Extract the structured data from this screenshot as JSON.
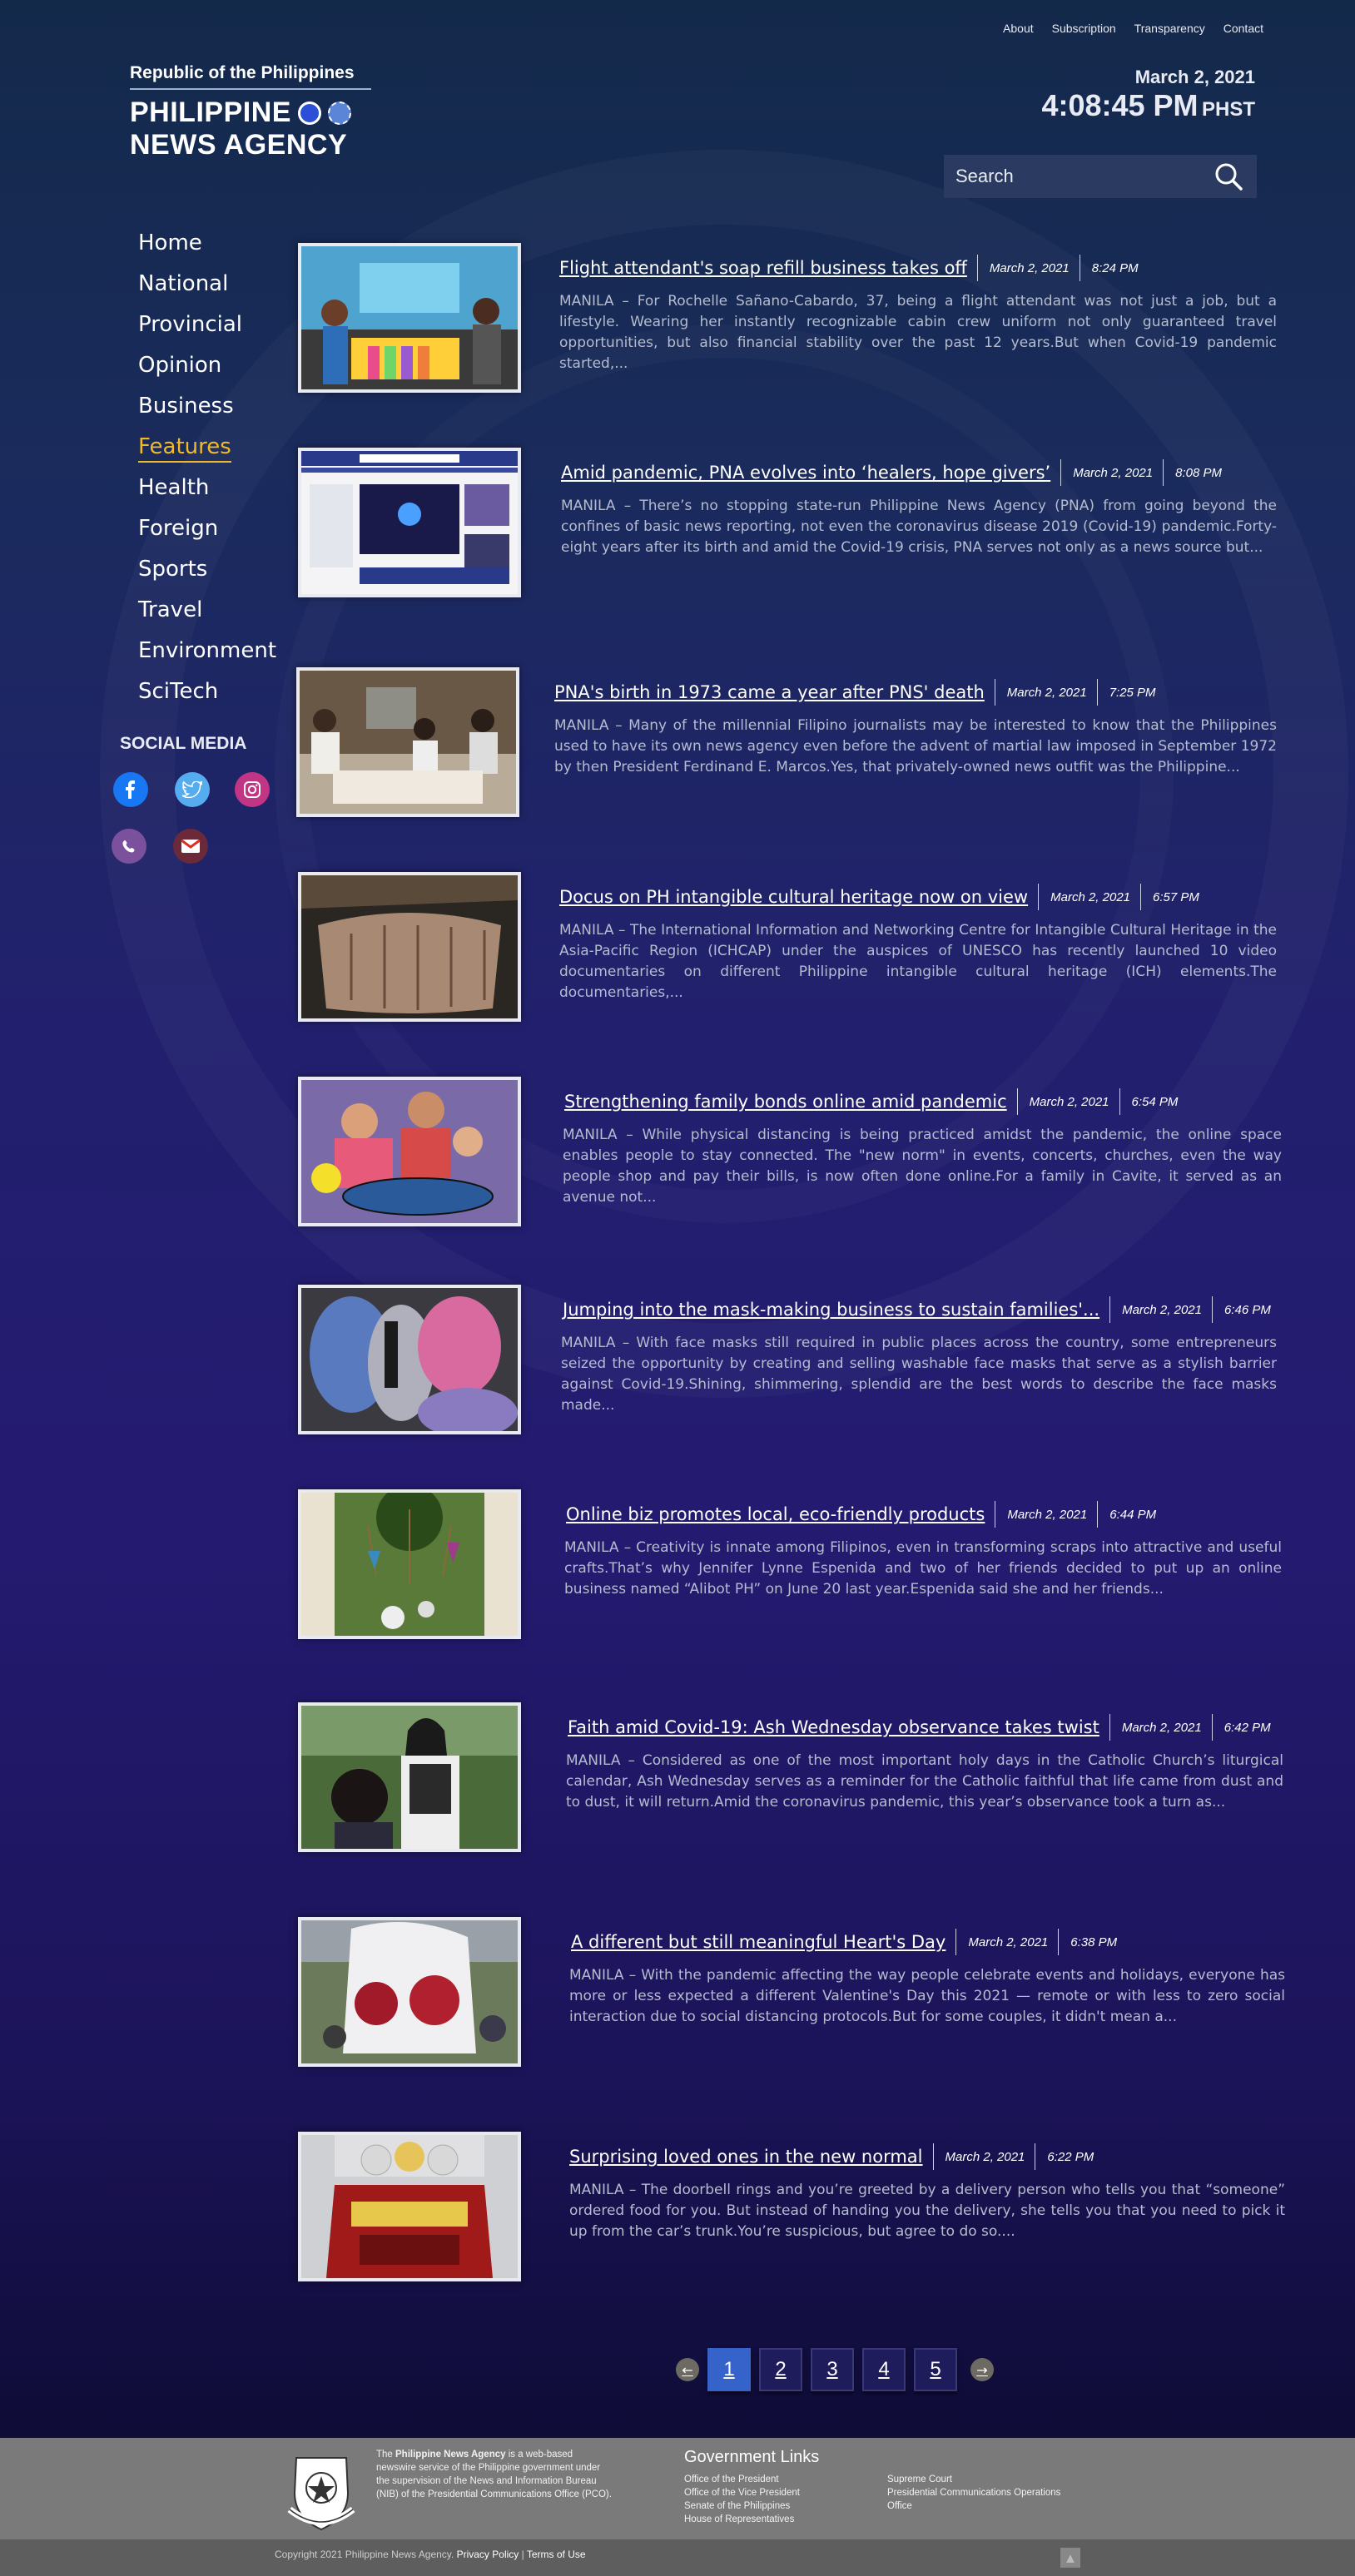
{
  "top_nav": [
    "About",
    "Subscription",
    "Transparency",
    "Contact"
  ],
  "logo": {
    "republic": "Republic of the Philippines",
    "line1": "PHILIPPINE",
    "line2": "NEWS AGENCY"
  },
  "clock": {
    "date": "March 2, 2021",
    "time": "4:08:45 PM",
    "tz": "PHST"
  },
  "search": {
    "placeholder": "Search"
  },
  "sidebar": {
    "items": [
      "Home",
      "National",
      "Provincial",
      "Opinion",
      "Business",
      "Features",
      "Health",
      "Foreign",
      "Sports",
      "Travel",
      "Environment",
      "SciTech"
    ],
    "active": "Features"
  },
  "social": {
    "title": "SOCIAL MEDIA",
    "icons": [
      "facebook-icon",
      "twitter-icon",
      "instagram-icon",
      "viber-icon",
      "gmail-icon"
    ]
  },
  "articles": [
    {
      "title": "Flight attendant's soap refill business takes off",
      "date": "March 2, 2021",
      "time": "8:24 PM",
      "excerpt": "MANILA – For Rochelle Sañano-Cabardo, 37, being a flight attendant was not just a job, but a lifestyle. Wearing her instantly recognizable cabin crew uniform not only guaranteed travel opportunities, but also financial stability over the past 12 years.But when Covid-19 pandemic started,..."
    },
    {
      "title": "Amid pandemic, PNA evolves into ‘healers, hope givers’",
      "date": "March 2, 2021",
      "time": "8:08 PM",
      "excerpt": "MANILA – There’s no stopping state-run Philippine News Agency (PNA) from going beyond the confines of basic news reporting, not even the coronavirus disease 2019 (Covid-19) pandemic.Forty-eight years after its birth and amid the Covid-19 crisis, PNA serves not only as a news source but..."
    },
    {
      "title": "PNA's birth in 1973 came a year after PNS' death",
      "date": "March 2, 2021",
      "time": "7:25 PM",
      "excerpt": "MANILA – Many of the millennial Filipino journalists may be interested to know that the Philippines used to have its own news agency even before the advent of martial law imposed in September 1972 by then President Ferdinand E. Marcos.Yes, that privately-owned news outfit was the Philippine..."
    },
    {
      "title": "Docus on PH intangible cultural heritage now on view",
      "date": "March 2, 2021",
      "time": "6:57 PM",
      "excerpt": "MANILA – The International Information and Networking Centre for Intangible Cultural Heritage in the Asia-Pacific Region (ICHCAP) under the auspices of UNESCO has recently launched 10 video documentaries on different Philippine intangible cultural heritage (ICH) elements.The documentaries,..."
    },
    {
      "title": "Strengthening family bonds online amid pandemic",
      "date": "March 2, 2021",
      "time": "6:54 PM",
      "excerpt": "MANILA – While physical distancing is being practiced amidst the pandemic, the online space enables people to stay connected. The \"new norm\" in events, concerts, churches, even the way people shop and pay their bills, is now often done online.For a family in Cavite, it served as an avenue not..."
    },
    {
      "title": "Jumping into the mask-making business to sustain families'...",
      "date": "March 2, 2021",
      "time": "6:46 PM",
      "excerpt": "MANILA – With face masks still required in public places across the country, some entrepreneurs seized the opportunity by creating and selling washable face masks that serve as a stylish barrier against Covid-19.Shining, shimmering, splendid are the best words to describe the face masks made..."
    },
    {
      "title": "Online biz promotes local, eco-friendly products",
      "date": "March 2, 2021",
      "time": "6:44 PM",
      "excerpt": "MANILA – Creativity is innate among Filipinos, even in transforming scraps into attractive and useful crafts.That’s why Jennifer Lynne Espenida and two of her friends decided to put up an online business named “Alibot PH” on June 20 last year.Espenida said she and her friends..."
    },
    {
      "title": "Faith amid Covid-19: Ash Wednesday observance takes twist",
      "date": "March 2, 2021",
      "time": "6:42 PM",
      "excerpt": "MANILA – Considered as one of the most important holy days in the Catholic Church’s liturgical calendar, Ash Wednesday serves as a reminder for the Catholic faithful that life came from dust and to dust, it will return.Amid the coronavirus pandemic, this year’s observance took a turn as..."
    },
    {
      "title": "A different but still meaningful Heart's Day",
      "date": "March 2, 2021",
      "time": "6:38 PM",
      "excerpt": "MANILA – With the pandemic affecting the way people celebrate events and holidays, everyone has more or less expected a different Valentine's Day this 2021 — remote or with less to zero social interaction due to social distancing protocols.But for some couples, it didn't mean a..."
    },
    {
      "title": "Surprising loved ones in the new normal",
      "date": "March 2, 2021",
      "time": "6:22 PM",
      "excerpt": "MANILA – The doorbell rings and you’re greeted by a delivery person who tells you that “someone” ordered food for you. But instead of handing you the delivery, she tells you that you need to pick it up from the car’s trunk.You’re suspicious, but agree to do so...."
    }
  ],
  "pagination": {
    "pages": [
      "1",
      "2",
      "3",
      "4",
      "5"
    ],
    "current": "1"
  },
  "footer": {
    "about_pre": "The ",
    "about_bold": "Philippine News Agency",
    "about_post": " is a web-based newswire service of the Philippine government under the supervision of the News and Information Bureau (NIB) of the Presidential Communications Office (PCO).",
    "gov_title": "Government Links",
    "gov_col1": [
      "Office of the President",
      "Office of the Vice President",
      "Senate of the Philippines",
      "House of Representatives"
    ],
    "gov_col2": [
      "Supreme Court",
      "Presidential Communications Operations",
      "Office"
    ],
    "copyright": "Copyright 2021 Philippine News Agency.",
    "privacy": "Privacy Policy",
    "terms": "Terms of Use"
  },
  "colors": {
    "accent": "#f2b928",
    "page_active": "#3563c9"
  }
}
